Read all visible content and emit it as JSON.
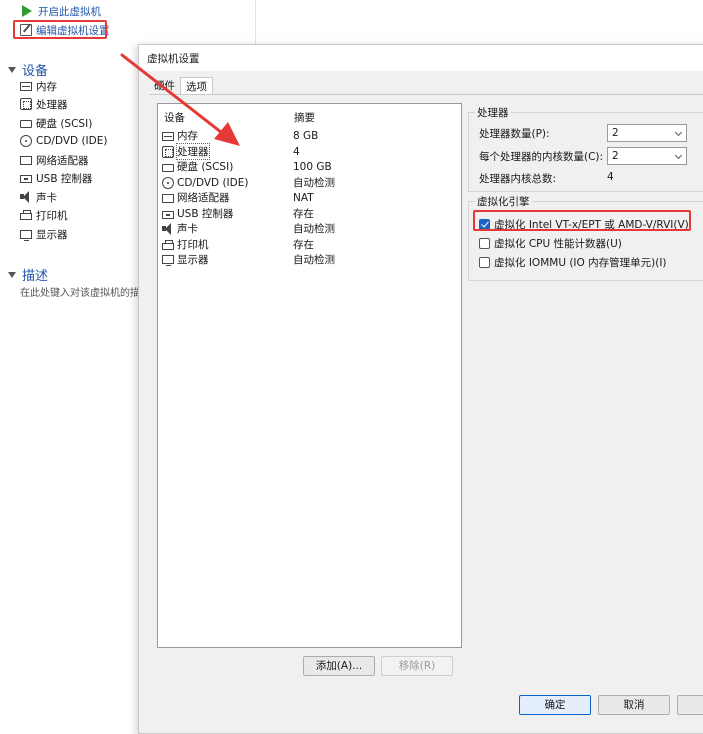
{
  "background": {
    "commands": {
      "power_on": "开启此虚拟机",
      "edit_settings": "编辑虚拟机设置"
    },
    "devices_header": "设备",
    "devices": [
      "内存",
      "处理器",
      "硬盘 (SCSI)",
      "CD/DVD (IDE)",
      "网络适配器",
      "USB 控制器",
      "声卡",
      "打印机",
      "显示器"
    ],
    "description_header": "描述",
    "description_hint": "在此处键入对该虚拟机的描"
  },
  "dialog": {
    "title": "虚拟机设置",
    "tabs": [
      "硬件",
      "选项"
    ],
    "list_headers": {
      "device": "设备",
      "summary": "摘要"
    },
    "device_rows": [
      {
        "icon": "memory-icon",
        "name": "内存",
        "summary": "8 GB"
      },
      {
        "icon": "processor-icon",
        "name": "处理器",
        "summary": "4",
        "selected": true
      },
      {
        "icon": "hard-disk-icon",
        "name": "硬盘 (SCSI)",
        "summary": "100 GB"
      },
      {
        "icon": "cd-dvd-icon",
        "name": "CD/DVD (IDE)",
        "summary": "自动检测"
      },
      {
        "icon": "network-adapter-icon",
        "name": "网络适配器",
        "summary": "NAT"
      },
      {
        "icon": "usb-controller-icon",
        "name": "USB 控制器",
        "summary": "存在"
      },
      {
        "icon": "sound-card-icon",
        "name": "声卡",
        "summary": "自动检测"
      },
      {
        "icon": "printer-icon",
        "name": "打印机",
        "summary": "存在"
      },
      {
        "icon": "display-icon",
        "name": "显示器",
        "summary": "自动检测"
      }
    ],
    "add_button": "添加(A)...",
    "remove_button": "移除(R)",
    "processors": {
      "group_title": "处理器",
      "count_label": "处理器数量(P):",
      "count_value": "2",
      "cores_label": "每个处理器的内核数量(C):",
      "cores_value": "2",
      "total_label": "处理器内核总数:",
      "total_value": "4"
    },
    "virtualization": {
      "group_title": "虚拟化引擎",
      "options": [
        {
          "label": "虚拟化 Intel VT-x/EPT 或 AMD-V/RVI(V)",
          "checked": true
        },
        {
          "label": "虚拟化 CPU 性能计数器(U)",
          "checked": false
        },
        {
          "label": "虚拟化 IOMMU (IO 内存管理单元)(I)",
          "checked": false
        }
      ]
    },
    "ok_button": "确定",
    "cancel_button": "取消"
  },
  "colors": {
    "annotation_red": "#e53935",
    "link_blue": "#2456a8",
    "check_blue": "#1e63c4"
  }
}
